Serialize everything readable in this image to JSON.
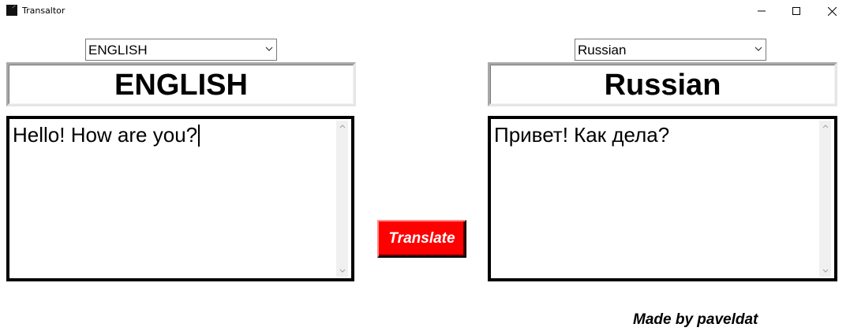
{
  "window": {
    "title": "Transaltor",
    "icon": "app-icon",
    "controls": [
      "minimize-icon",
      "maximize-icon",
      "close-icon"
    ]
  },
  "source": {
    "dropdown_value": "ENGLISH",
    "header": "ENGLISH",
    "text": "Hello! How are you?"
  },
  "target": {
    "dropdown_value": "Russian",
    "header": "Russian",
    "text": "Привет! Как дела?"
  },
  "actions": {
    "translate_label": "Translate",
    "translate_color": "#ff0000"
  },
  "footer": {
    "credit": "Made by paveldat"
  }
}
